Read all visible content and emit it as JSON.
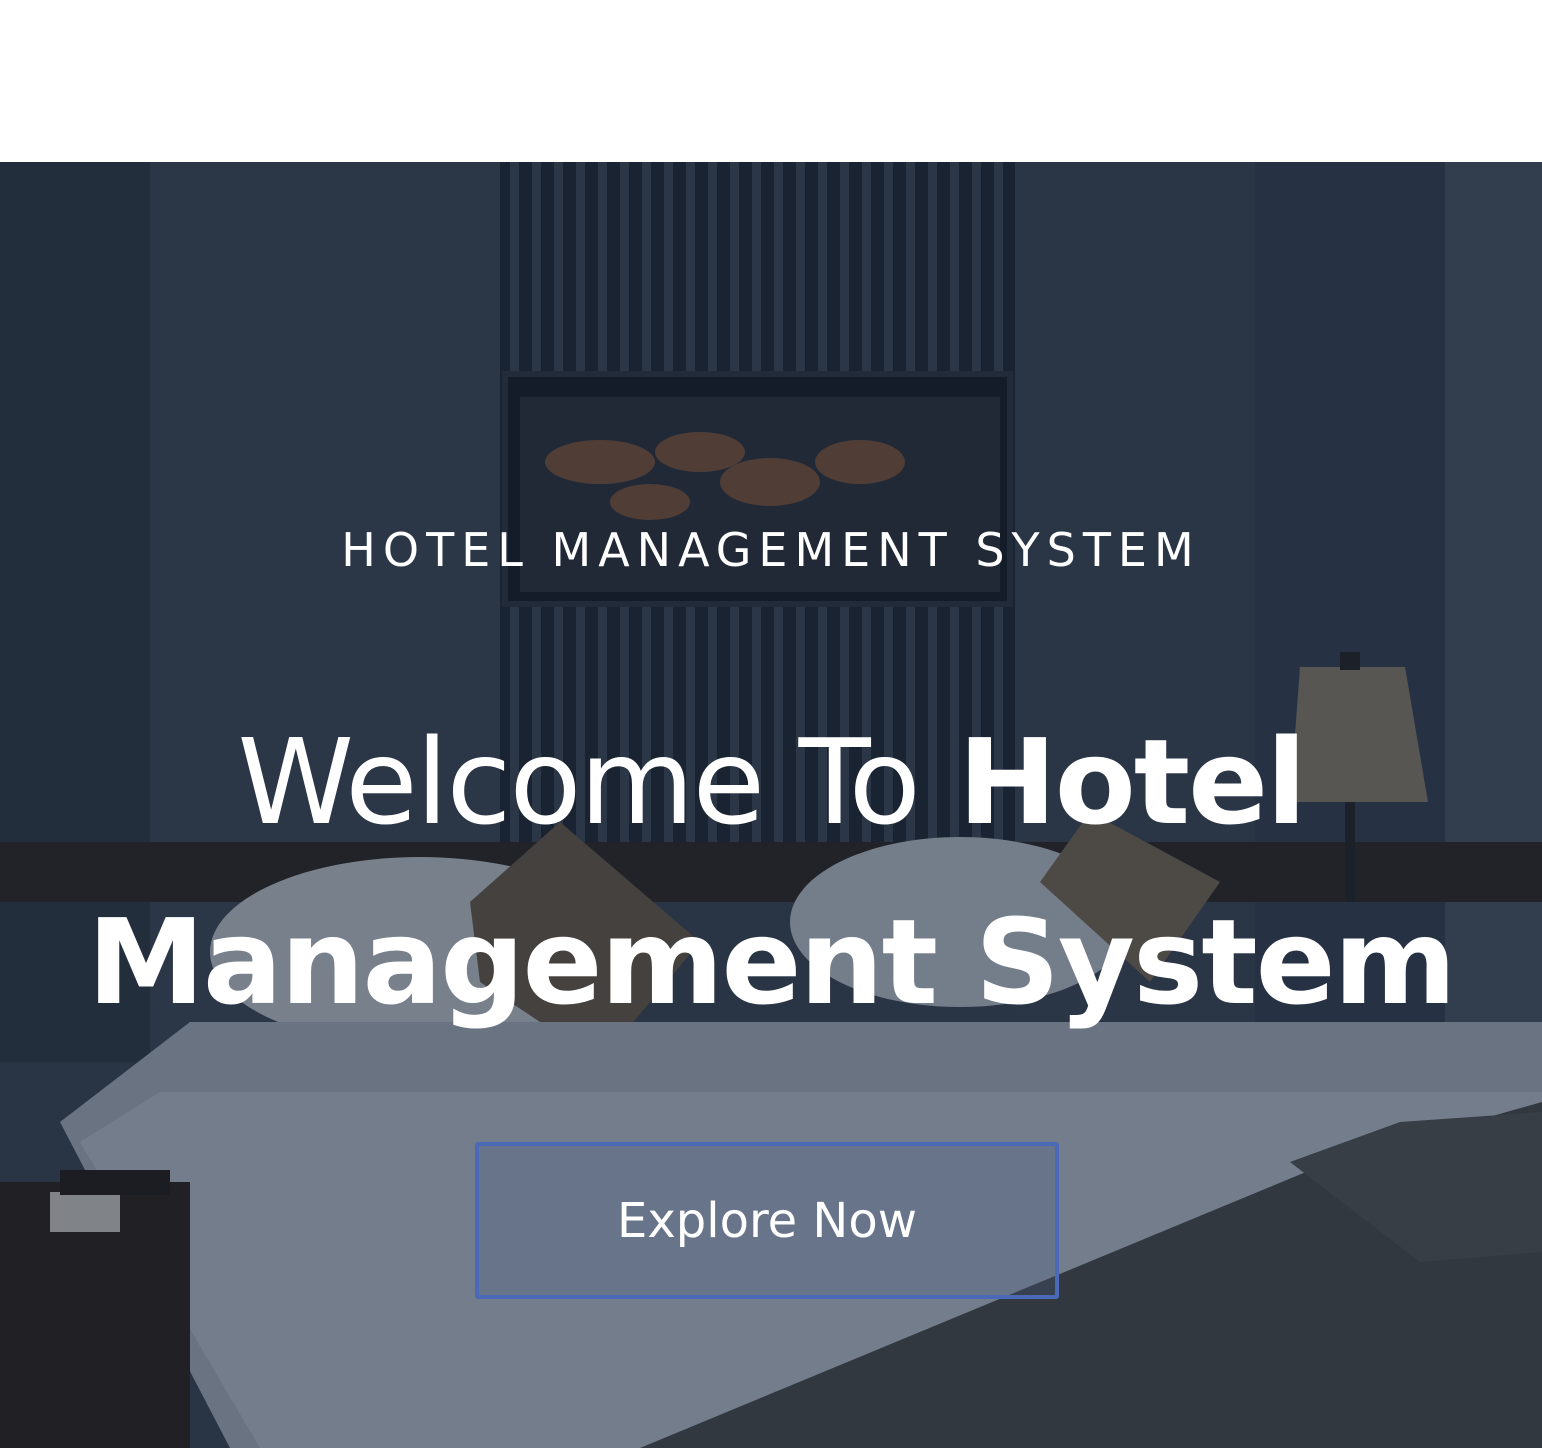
{
  "hero": {
    "eyebrow": "HOTEL MANAGEMENT SYSTEM",
    "headline_light": "Welcome To",
    "headline_bold_line1": "Hotel",
    "headline_bold_line2": "Management System",
    "cta_label": "Explore Now"
  },
  "colors": {
    "overlay": "#162234",
    "cta_border": "#4a6ab8",
    "text": "#ffffff"
  }
}
